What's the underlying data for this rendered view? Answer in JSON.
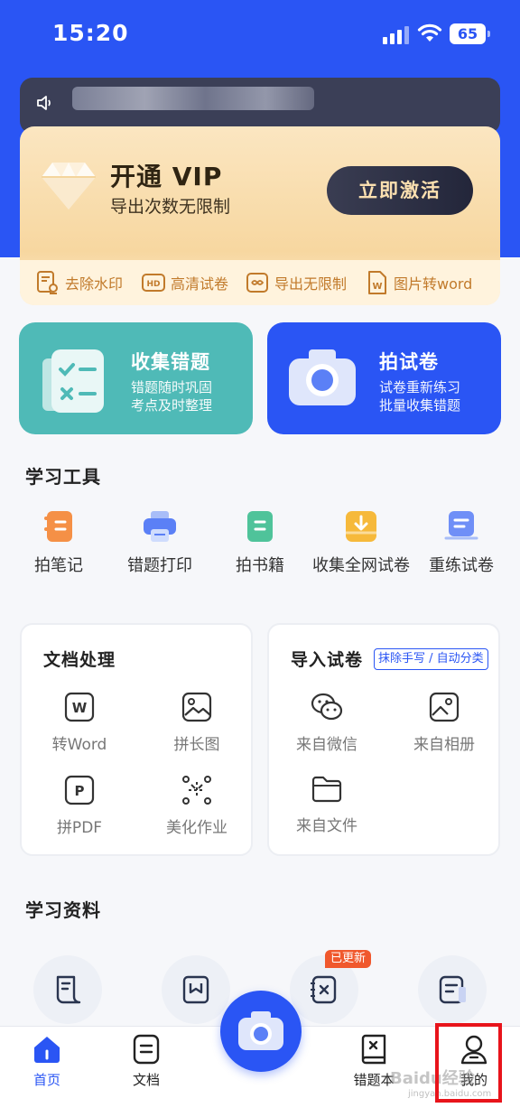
{
  "status_bar": {
    "time": "15:20",
    "battery": "65"
  },
  "vip": {
    "title": "开通 VIP",
    "subtitle": "导出次数无限制",
    "button": "立即激活",
    "perks": [
      "去除水印",
      "高清试卷",
      "导出无限制",
      "图片转word"
    ]
  },
  "features": [
    {
      "title": "收集错题",
      "lines": [
        "错题随时巩固",
        "考点及时整理"
      ]
    },
    {
      "title": "拍试卷",
      "lines": [
        "试卷重新练习",
        "批量收集错题"
      ]
    }
  ],
  "tools": {
    "title": "学习工具",
    "items": [
      "拍笔记",
      "错题打印",
      "拍书籍",
      "收集全网试卷",
      "重练试卷"
    ]
  },
  "doc_panel": {
    "title": "文档处理",
    "items": [
      "转Word",
      "拼长图",
      "拼PDF",
      "美化作业"
    ]
  },
  "import_panel": {
    "title": "导入试卷",
    "badge": "抹除手写 / 自动分类",
    "items": [
      "来自微信",
      "来自相册",
      "来自文件"
    ]
  },
  "resources": {
    "title": "学习资料",
    "updated_badge": "已更新"
  },
  "tabbar": {
    "items": [
      "首页",
      "文档",
      "错题本",
      "我的"
    ]
  },
  "watermark": {
    "main": "Baidu经验",
    "sub": "jingyan.baidu.com"
  },
  "colors": {
    "primary": "#2a55f4",
    "teal": "#4fbab7",
    "vip_gold": "#f7d7a0",
    "highlight": "#e8141b"
  }
}
